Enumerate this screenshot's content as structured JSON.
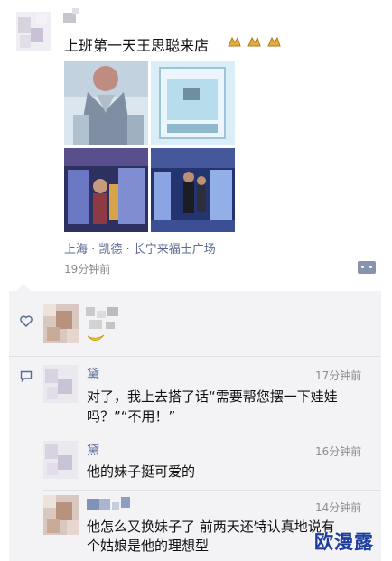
{
  "post": {
    "text": "上班第一天王思聪来店",
    "location": "上海 · 凯德 · 长宁来福士广场",
    "time": "19分钟前",
    "emoji": "bow-hands-emoji"
  },
  "comments": [
    {
      "name": "黛",
      "time": "17分钟前",
      "line1": "对了，我上去搭了话“需要帮您摆一下娃娃",
      "line2": "吗？”“不用！”"
    },
    {
      "name": "黛",
      "time": "16分钟前",
      "line1": "他的妹子挺可爱的"
    },
    {
      "name": "",
      "time": "14分钟前",
      "line1": "他怎么又换妹子了 前两天还特认真地说有",
      "line2": "个姑娘是他的理想型"
    }
  ],
  "watermark": "欧漫露",
  "colors": {
    "link": "#576b95",
    "panel": "#f3f3f5",
    "watermark": "#1f3d9e"
  }
}
